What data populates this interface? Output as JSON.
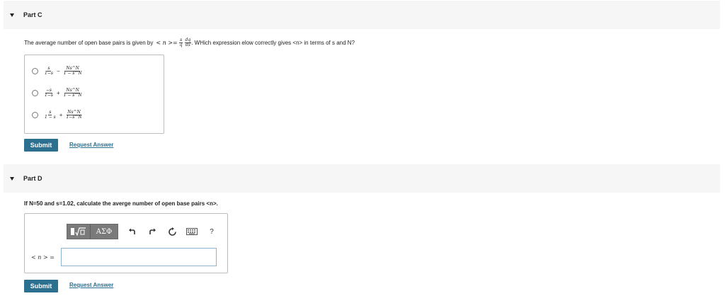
{
  "partC": {
    "title": "Part C",
    "question_prefix": "The average number of open base pairs is given by",
    "question_lhs": "< n >=",
    "question_frac1_num": "s",
    "question_frac1_den": "q",
    "question_frac2_num": "dq",
    "question_frac2_den": "ds",
    "question_suffix": ". WHich expression elow correctly gives <n> in terms of s and N?",
    "options": [
      {
        "frac1_num": "s",
        "frac1_den": "1−s",
        "operator": "−",
        "frac2_num": "Ns^N",
        "frac2_den": "1 − s^N"
      },
      {
        "frac1_num": "−s",
        "frac1_den": "1−s",
        "operator": "+",
        "frac2_num": "Ns^N",
        "frac2_den": "1 − s^N"
      },
      {
        "frac1_num": "s",
        "frac1_den": "1 − s",
        "operator": "+",
        "frac2_num": "Ns^N",
        "frac2_den": "1−s^N"
      }
    ],
    "submit_label": "Submit",
    "request_label": "Request Answer"
  },
  "partD": {
    "title": "Part D",
    "question": "If N=50 and s=1.02, calculate the averge number of open base pairs <n>.",
    "toolbar": {
      "template_icon": "fraction-radical-template-icon",
      "greek_label": "ΑΣΦ",
      "undo_icon": "undo-icon",
      "redo_icon": "redo-icon",
      "reset_icon": "reset-icon",
      "keyboard_icon": "keyboard-icon",
      "help_label": "?"
    },
    "answer_label": "< n > =",
    "answer_value": "",
    "submit_label": "Submit",
    "request_label": "Request Answer"
  },
  "colors": {
    "accent": "#2d6f8e",
    "header_bg": "#f6f6f6",
    "toolbar": "#7a7a7a"
  }
}
